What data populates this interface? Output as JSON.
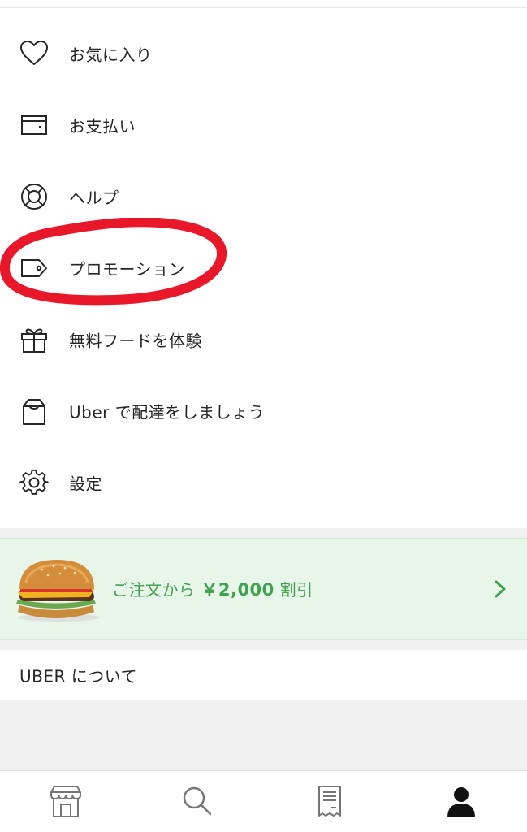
{
  "menu": {
    "items": [
      {
        "label": "お気に入り",
        "icon": "heart-icon"
      },
      {
        "label": "お支払い",
        "icon": "wallet-icon"
      },
      {
        "label": "ヘルプ",
        "icon": "lifebuoy-icon"
      },
      {
        "label": "プロモーション",
        "icon": "tag-icon"
      },
      {
        "label": "無料フードを体験",
        "icon": "gift-icon"
      },
      {
        "label": "Uber で配達をしましょう",
        "icon": "bag-icon"
      },
      {
        "label": "設定",
        "icon": "gear-icon"
      }
    ]
  },
  "promo": {
    "text_prefix": "ご注文から",
    "amount": "￥2,000",
    "text_suffix": "割引",
    "accent_color": "#3ea24e",
    "background_color": "#e8f5e9"
  },
  "about": {
    "label": "UBER について"
  },
  "highlight": {
    "color": "#e8182a"
  },
  "tabbar": {
    "tabs": [
      {
        "icon": "store-icon"
      },
      {
        "icon": "search-icon"
      },
      {
        "icon": "receipt-icon"
      },
      {
        "icon": "account-icon",
        "active": true
      }
    ]
  }
}
